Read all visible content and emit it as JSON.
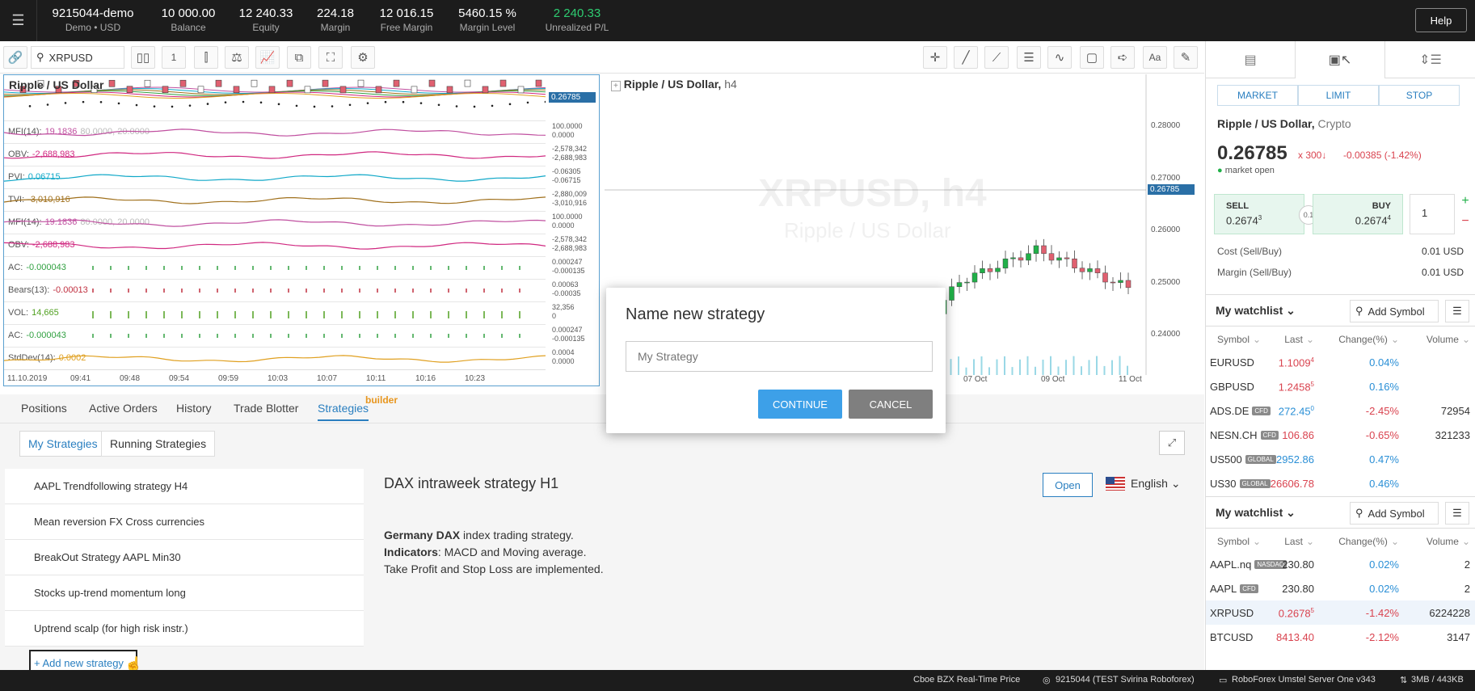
{
  "topbar": {
    "account": {
      "value": "9215044-demo",
      "label": "Demo • USD"
    },
    "balance": {
      "value": "10 000.00",
      "label": "Balance"
    },
    "equity": {
      "value": "12 240.33",
      "label": "Equity"
    },
    "margin": {
      "value": "224.18",
      "label": "Margin"
    },
    "free_margin": {
      "value": "12 016.15",
      "label": "Free Margin"
    },
    "margin_level": {
      "value": "5460.15 %",
      "label": "Margin Level"
    },
    "unrealized": {
      "value": "2 240.33",
      "label": "Unrealized P/L"
    },
    "help": "Help",
    "menu_icon": "hamburger-icon"
  },
  "toolbar": {
    "symbol": "XRPUSD",
    "interval": "1"
  },
  "chart_left": {
    "title": "Ripple / US Dollar",
    "price_tag": "0.26785",
    "date_start": "11.10.2019",
    "times": [
      "09:41",
      "09:48",
      "09:54",
      "09:59",
      "10:03",
      "10:07",
      "10:11",
      "10:16",
      "10:23"
    ],
    "indicators": [
      {
        "name": "MFI(14):",
        "value": "19.1836",
        "extra": "80.0000, 20.0000",
        "color": "#c050a0",
        "scale": [
          "100.0000",
          "0.0000"
        ]
      },
      {
        "name": "OBV:",
        "value": "-2,688,983",
        "extra": "",
        "color": "#d02880",
        "scale": [
          "-2,578,342",
          "-2,688,983"
        ]
      },
      {
        "name": "PVI:",
        "value": "0.06715",
        "extra": "",
        "color": "#10a8c8",
        "scale": [
          "-0.06305",
          "-0.06715"
        ]
      },
      {
        "name": "TVI:",
        "value": "-3,010,916",
        "extra": "",
        "color": "#a0701c",
        "scale": [
          "-2,880,009",
          "-3,010,916"
        ]
      },
      {
        "name": "MFI(14):",
        "value": "19.1836",
        "extra": "80.0000, 20.0000",
        "color": "#c050a0",
        "scale": [
          "100.0000",
          "0.0000"
        ]
      },
      {
        "name": "OBV:",
        "value": "-2,688,983",
        "extra": "",
        "color": "#d02880",
        "scale": [
          "-2,578,342",
          "-2,688,983"
        ]
      },
      {
        "name": "AC:",
        "value": "-0.000043",
        "extra": "",
        "color": "#30a040",
        "scale": [
          "0.000247",
          "-0.000135"
        ]
      },
      {
        "name": "Bears(13):",
        "value": "-0.00013",
        "extra": "",
        "color": "#c03040",
        "scale": [
          "0.00063",
          "-0.00035"
        ]
      },
      {
        "name": "VOL:",
        "value": "14,665",
        "extra": "",
        "color": "#50a020",
        "scale": [
          "32,356",
          "0"
        ]
      },
      {
        "name": "AC:",
        "value": "-0.000043",
        "extra": "",
        "color": "#30a040",
        "scale": [
          "0.000247",
          "-0.000135"
        ]
      },
      {
        "name": "StdDev(14):",
        "value": "0.0002",
        "extra": "",
        "color": "#e0a020",
        "scale": [
          "0.0004",
          "0.0000"
        ]
      }
    ]
  },
  "chart_right": {
    "title": "Ripple / US Dollar,",
    "interval": "h4",
    "watermark_symbol": "XRPUSD, h4",
    "watermark_name": "Ripple / US Dollar",
    "price_tag": "0.26785",
    "prices": [
      "0.28000",
      "0.27000",
      "0.26000",
      "0.25000",
      "0.24000"
    ],
    "dates": [
      "07 Oct",
      "09 Oct",
      "11 Oct"
    ]
  },
  "bottom_tabs": {
    "positions": "Positions",
    "active_orders": "Active Orders",
    "history": "History",
    "trade_blotter": "Trade Blotter",
    "strategies": "Strategies",
    "builder": "builder"
  },
  "strategies": {
    "tab_mine": "My Strategies",
    "tab_running": "Running Strategies",
    "items": [
      "AAPL Trendfollowing strategy H4",
      "Mean reversion FX Cross currencies",
      "BreakOut Strategy AAPL Min30",
      "Stocks up-trend momentum long",
      "Uptrend scalp (for high risk instr.)"
    ],
    "add_new": "+ Add new strategy",
    "detail_title": "DAX intraweek strategy H1",
    "open_btn": "Open",
    "language": "English",
    "desc_bold1": "Germany DAX",
    "desc_text1": " index trading strategy.",
    "desc_bold2": "Indicators",
    "desc_text2": ": MACD and Moving average.",
    "desc_line3": "Take Profit and Stop Loss are implemented."
  },
  "order": {
    "types": [
      "MARKET",
      "LIMIT",
      "STOP"
    ],
    "instrument": "Ripple / US Dollar,",
    "category": "Crypto",
    "price": "0.26785",
    "multiplier": "x 300↓",
    "change": "-0.00385 (-1.42%)",
    "status": "market open",
    "sell_label": "SELL",
    "sell_price": "0.2674",
    "sell_sup": "3",
    "spread": "0.1",
    "buy_label": "BUY",
    "buy_price": "0.2674",
    "buy_sup": "4",
    "qty": "1",
    "cost_label": "Cost (Sell/Buy)",
    "cost_value": "0.01 USD",
    "margin_label": "Margin (Sell/Buy)",
    "margin_value": "0.01 USD"
  },
  "watchlist1": {
    "title": "My watchlist",
    "add": "Add Symbol",
    "cols": [
      "Symbol",
      "Last",
      "Change(%)",
      "Volume"
    ],
    "rows": [
      {
        "sym": "EURUSD",
        "badge": "",
        "last": "1.1009",
        "sup": "4",
        "chg": "0.04%",
        "vol": "",
        "lc": "red",
        "cc": "blue"
      },
      {
        "sym": "GBPUSD",
        "badge": "",
        "last": "1.2458",
        "sup": "5",
        "chg": "0.16%",
        "vol": "",
        "lc": "red",
        "cc": "blue"
      },
      {
        "sym": "ADS.DE",
        "badge": "CFD",
        "last": "272.45",
        "sup": "0",
        "chg": "-2.45%",
        "vol": "72954",
        "lc": "blue",
        "cc": "red"
      },
      {
        "sym": "NESN.CH",
        "badge": "CFD",
        "last": "106.86",
        "sup": "",
        "chg": "-0.65%",
        "vol": "321233",
        "lc": "red",
        "cc": "red"
      },
      {
        "sym": "US500",
        "badge": "GLOBAL",
        "last": "2952.86",
        "sup": "",
        "chg": "0.47%",
        "vol": "",
        "lc": "blue",
        "cc": "blue"
      },
      {
        "sym": "US30",
        "badge": "GLOBAL",
        "last": "26606.78",
        "sup": "",
        "chg": "0.46%",
        "vol": "",
        "lc": "red",
        "cc": "blue"
      }
    ]
  },
  "watchlist2": {
    "title": "My watchlist",
    "add": "Add Symbol",
    "cols": [
      "Symbol",
      "Last",
      "Change(%)",
      "Volume"
    ],
    "rows": [
      {
        "sym": "AAPL.nq",
        "badge": "NASDAQ",
        "last": "230.80",
        "sup": "",
        "chg": "0.02%",
        "vol": "2",
        "lc": "",
        "cc": "blue"
      },
      {
        "sym": "AAPL",
        "badge": "CFD",
        "last": "230.80",
        "sup": "",
        "chg": "0.02%",
        "vol": "2",
        "lc": "",
        "cc": "blue"
      },
      {
        "sym": "XRPUSD",
        "badge": "",
        "last": "0.2678",
        "sup": "5",
        "chg": "-1.42%",
        "vol": "6224228",
        "lc": "red",
        "cc": "red"
      },
      {
        "sym": "BTCUSD",
        "badge": "",
        "last": "8413.40",
        "sup": "",
        "chg": "-2.12%",
        "vol": "3147",
        "lc": "red",
        "cc": "red"
      }
    ]
  },
  "statusbar": {
    "feed": "Cboe BZX Real-Time Price",
    "account": "9215044 (TEST Svirina Roboforex)",
    "server": "RoboForex Umstel Server One v343",
    "memory": "3MB / 443KB"
  },
  "modal": {
    "title": "Name new strategy",
    "placeholder": "My Strategy",
    "continue": "CONTINUE",
    "cancel": "CANCEL"
  }
}
